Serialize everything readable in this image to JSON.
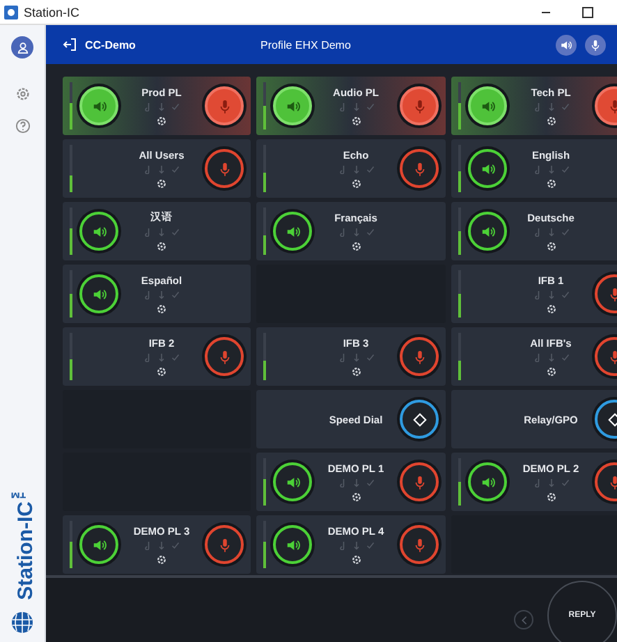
{
  "window": {
    "title": "Station-IC"
  },
  "sidebar": {
    "logo_text": "Station-IC$^{™}$"
  },
  "header": {
    "account": "CC-Demo",
    "profile": "Profile EHX Demo"
  },
  "cells": [
    {
      "kind": "channel",
      "name": "Prod PL",
      "level": 0.55,
      "buttons": [
        {
          "kind": "listen",
          "on": true
        },
        {
          "kind": "talk",
          "on": true
        }
      ]
    },
    {
      "kind": "channel",
      "name": "Audio PL",
      "level": 0.5,
      "buttons": [
        {
          "kind": "listen",
          "on": true
        },
        {
          "kind": "talk",
          "on": true
        }
      ]
    },
    {
      "kind": "channel",
      "name": "Tech PL",
      "level": 0.55,
      "buttons": [
        {
          "kind": "listen",
          "on": true
        },
        {
          "kind": "talk",
          "on": true
        }
      ]
    },
    {
      "kind": "channel",
      "name": "All Users",
      "level": 0.35,
      "buttons": [
        {
          "kind": "talk",
          "on": false
        }
      ]
    },
    {
      "kind": "channel",
      "name": "Echo",
      "level": 0.4,
      "buttons": [
        {
          "kind": "talk",
          "on": false
        }
      ]
    },
    {
      "kind": "channel",
      "name": "English",
      "level": 0.45,
      "buttons": [
        {
          "kind": "listen",
          "on": false
        }
      ]
    },
    {
      "kind": "channel",
      "name": "汉语",
      "level": 0.55,
      "buttons": [
        {
          "kind": "listen",
          "on": false
        }
      ]
    },
    {
      "kind": "channel",
      "name": "Français",
      "level": 0.4,
      "buttons": [
        {
          "kind": "listen",
          "on": false
        }
      ]
    },
    {
      "kind": "channel",
      "name": "Deutsche",
      "level": 0.5,
      "buttons": [
        {
          "kind": "listen",
          "on": false
        }
      ]
    },
    {
      "kind": "channel",
      "name": "Español",
      "level": 0.5,
      "buttons": [
        {
          "kind": "listen",
          "on": false
        }
      ]
    },
    {
      "kind": "empty"
    },
    {
      "kind": "channel",
      "name": "IFB 1",
      "level": 0.5,
      "buttons": [
        {
          "kind": "talk",
          "on": false
        }
      ]
    },
    {
      "kind": "channel",
      "name": "IFB 2",
      "level": 0.45,
      "buttons": [
        {
          "kind": "talk",
          "on": false
        }
      ]
    },
    {
      "kind": "channel",
      "name": "IFB 3",
      "level": 0.4,
      "buttons": [
        {
          "kind": "talk",
          "on": false
        }
      ]
    },
    {
      "kind": "channel",
      "name": "All IFB's",
      "level": 0.4,
      "buttons": [
        {
          "kind": "talk",
          "on": false
        }
      ]
    },
    {
      "kind": "empty"
    },
    {
      "kind": "speed_dial",
      "name": "Speed Dial"
    },
    {
      "kind": "speed_dial",
      "name": "Relay/GPO"
    },
    {
      "kind": "empty"
    },
    {
      "kind": "channel",
      "name": "DEMO PL 1",
      "level": 0.55,
      "buttons": [
        {
          "kind": "listen",
          "on": false
        },
        {
          "kind": "talk",
          "on": false
        }
      ]
    },
    {
      "kind": "channel",
      "name": "DEMO PL 2",
      "level": 0.5,
      "buttons": [
        {
          "kind": "listen",
          "on": false
        },
        {
          "kind": "talk",
          "on": false
        }
      ]
    },
    {
      "kind": "channel",
      "name": "DEMO PL 3",
      "level": 0.55,
      "buttons": [
        {
          "kind": "listen",
          "on": false
        },
        {
          "kind": "talk",
          "on": false
        }
      ]
    },
    {
      "kind": "channel",
      "name": "DEMO PL 4",
      "level": 0.55,
      "buttons": [
        {
          "kind": "listen",
          "on": false
        },
        {
          "kind": "talk",
          "on": false
        }
      ]
    },
    {
      "kind": "empty"
    }
  ],
  "footer": {
    "reply": "REPLY"
  }
}
